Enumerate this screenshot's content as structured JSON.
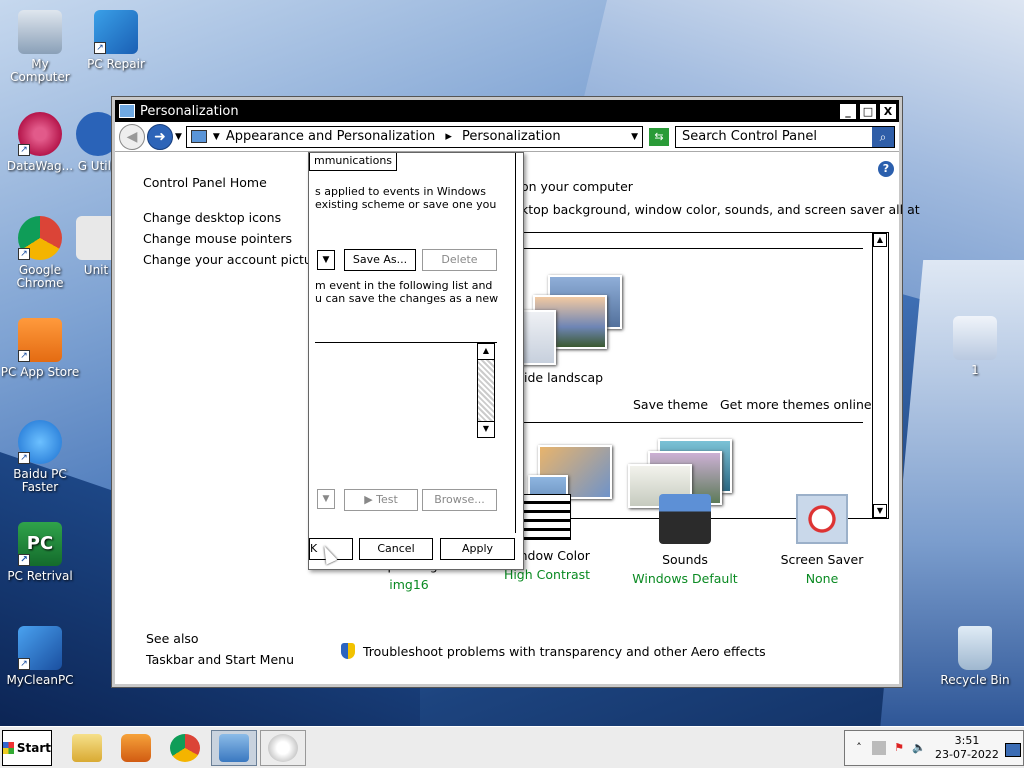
{
  "desktop": {
    "icons": [
      {
        "label": "My Computer"
      },
      {
        "label": "PC Repair"
      },
      {
        "label": "DataWag..."
      },
      {
        "label": "G Utili"
      },
      {
        "label": "Google Chrome"
      },
      {
        "label": "Unit"
      },
      {
        "label": "PC App Store"
      },
      {
        "label": "Baidu PC Faster"
      },
      {
        "label": "PC Retrival"
      },
      {
        "label": "MyCleanPC"
      },
      {
        "label": "1"
      },
      {
        "label": "Recycle Bin"
      }
    ]
  },
  "window": {
    "title": "Personalization",
    "minimize": "_",
    "maximize": "□",
    "close": "X",
    "address": {
      "crumb1": "Appearance and Personalization",
      "sep": "▸",
      "crumb2": "Personalization"
    },
    "search_placeholder": "Search Control Panel",
    "help": "?",
    "left_nav": {
      "home": "Control Panel Home",
      "items": [
        "Change desktop icons",
        "Change mouse pointers",
        "Change your account picture"
      ]
    },
    "heading1": "on your computer",
    "heading2": "ktop background, window color, sounds, and screen saver all at",
    "theme_name": "ide landscap",
    "save_theme": "Save theme",
    "more_themes": "Get more themes online",
    "bottom": [
      {
        "label": "Desktop Background",
        "sub": "img16"
      },
      {
        "label": "Window Color",
        "sub": "High Contrast"
      },
      {
        "label": "Sounds",
        "sub": "Windows Default"
      },
      {
        "label": "Screen Saver",
        "sub": "None"
      }
    ],
    "see_also": "See also",
    "taskbar_link": "Taskbar and Start Menu",
    "troubleshoot": "Troubleshoot problems with transparency and other Aero effects"
  },
  "sound_dialog": {
    "tab": "mmunications",
    "line1": "s applied to events in Windows",
    "line2": "existing scheme or save one you",
    "save_as": "Save As...",
    "delete": "Delete",
    "line3": "m event in the following list and",
    "line4": "u can save the changes as a new",
    "test": "▶ Test",
    "browse": "Browse...",
    "ok": "K",
    "cancel": "Cancel",
    "apply": "Apply"
  },
  "taskbar": {
    "start": "Start",
    "time": "3:51",
    "date": "23-07-2022"
  }
}
